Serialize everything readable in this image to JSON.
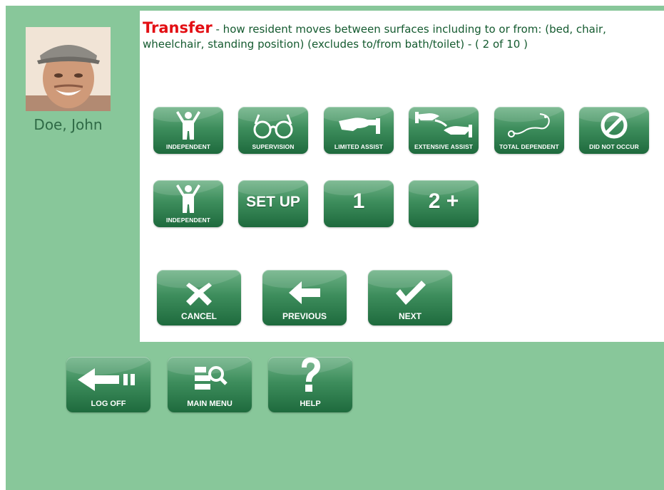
{
  "resident": {
    "name": "Doe, John"
  },
  "question": {
    "keyword": "Transfer",
    "description": " - how resident moves between surfaces including to or from: (bed, chair, wheelchair, standing position) (excludes to/from bath/toilet) - ( 2 of 10 )"
  },
  "self_performance": [
    {
      "label": "INDEPENDENT",
      "icon": "person-arms-up-icon"
    },
    {
      "label": "SUPERVISION",
      "icon": "glasses-icon"
    },
    {
      "label": "LIMITED ASSIST",
      "icon": "helping-hand-icon"
    },
    {
      "label": "EXTENSIVE ASSIST",
      "icon": "two-hands-icon"
    },
    {
      "label": "TOTAL DEPENDENT",
      "icon": "stethoscope-icon"
    },
    {
      "label": "DID NOT OCCUR",
      "icon": "prohibited-icon"
    }
  ],
  "support": [
    {
      "label": "INDEPENDENT",
      "icon": "person-arms-up-icon"
    },
    {
      "text": "SET UP"
    },
    {
      "text": "1"
    },
    {
      "text": "2 +"
    }
  ],
  "actions": {
    "cancel": "CANCEL",
    "previous": "PREVIOUS",
    "next": "NEXT"
  },
  "footer": {
    "log_off": "LOG OFF",
    "main_menu": "MAIN MENU",
    "help": "HELP"
  },
  "colors": {
    "background": "#88c79a",
    "button_green": "#2f7d4c",
    "keyword_red": "#e30f14",
    "text_green": "#145a2f"
  }
}
